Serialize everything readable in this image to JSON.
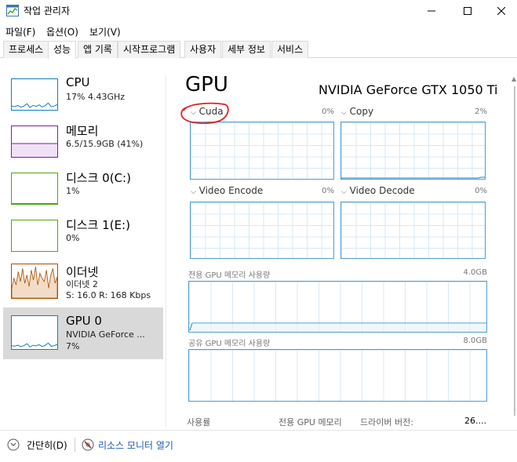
{
  "window": {
    "title": "작업 관리자"
  },
  "menu": [
    "파일(F)",
    "옵션(O)",
    "보기(V)"
  ],
  "tabs": [
    "프로세스",
    "성능",
    "앱 기록",
    "시작프로그램",
    "사용자",
    "세부 정보",
    "서비스"
  ],
  "active_tab": "성능",
  "sidebar": {
    "items": [
      {
        "title": "CPU",
        "sub1": "17% 4.43GHz",
        "sub2": "",
        "color": "#117dbb"
      },
      {
        "title": "메모리",
        "sub1": "6.5/15.9GB (41%)",
        "sub2": "",
        "color": "#8b12ae"
      },
      {
        "title": "디스크 0(C:)",
        "sub1": "1%",
        "sub2": "",
        "color": "#4da60c"
      },
      {
        "title": "디스크 1(E:)",
        "sub1": "0%",
        "sub2": "",
        "color": "#4da60c"
      },
      {
        "title": "이더넷",
        "sub1": "이더넷 2",
        "sub2": "S: 16.0  R: 168 Kbps",
        "color": "#a74f01"
      },
      {
        "title": "GPU 0",
        "sub1": "NVIDIA GeForce ...",
        "sub2": "7%",
        "color": "#117dbb"
      }
    ],
    "cpu_levels": [
      0.1,
      0.08,
      0.12,
      0.06,
      0.1,
      0.18,
      0.05,
      0.12,
      0.09,
      0.14,
      0.07,
      0.11,
      0.2,
      0.08,
      0.1,
      0.15
    ],
    "eth_levels": [
      0.3,
      0.6,
      0.4,
      0.8,
      0.5,
      0.9,
      0.45,
      0.7,
      0.35,
      0.85,
      0.55,
      0.95,
      0.4,
      0.75,
      0.6,
      0.5,
      0.85,
      0.3,
      0.7,
      0.9,
      0.45,
      0.65
    ]
  },
  "main": {
    "heading": "GPU",
    "model": "NVIDIA GeForce GTX 1050 Ti",
    "engines": [
      {
        "label": "Cuda",
        "pct": "0%"
      },
      {
        "label": "Copy",
        "pct": "2%"
      },
      {
        "label": "Video Encode",
        "pct": "0%"
      },
      {
        "label": "Video Decode",
        "pct": "0%"
      }
    ],
    "dedicated_label": "전용 GPU 메모리 사용량",
    "dedicated_max": "4.0GB",
    "shared_label": "공유 GPU 메모리 사용량",
    "shared_max": "8.0GB",
    "stats": {
      "usage_label": "사용률",
      "dedicated_label": "전용 GPU 메모리",
      "driver_label": "드라이버 버전:",
      "driver_value": "26...."
    }
  },
  "footer": {
    "collapse": "간단히(D)",
    "resmon": "리소스 모니터 열기"
  }
}
